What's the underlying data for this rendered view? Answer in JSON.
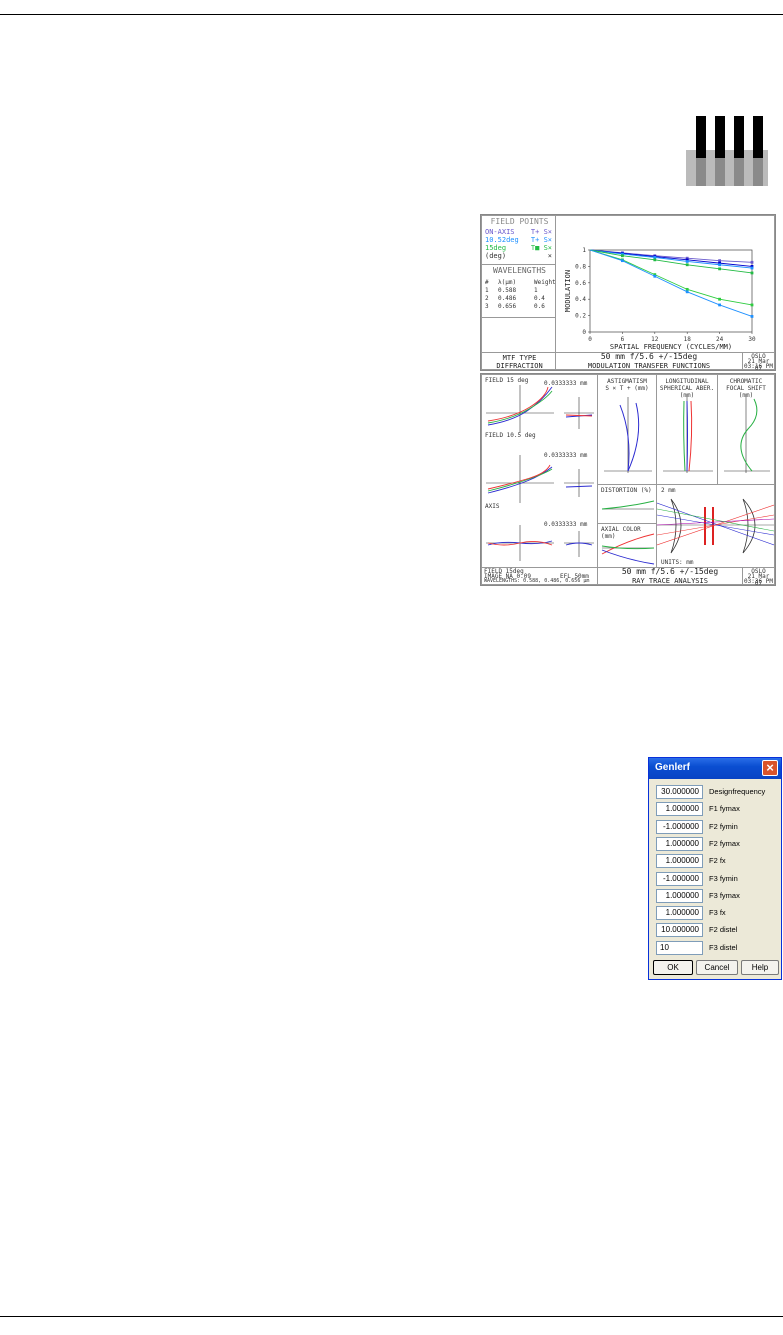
{
  "mtf_panel": {
    "field_points": {
      "title": "FIELD POINTS",
      "rows": [
        {
          "label": "ON-AXIS",
          "ts": "T+ S×",
          "color": "#6a5acd"
        },
        {
          "label": "10.52deg",
          "ts": "T+ S×",
          "color": "#1e90ff"
        },
        {
          "label": "15deg",
          "ts": "T■ S×",
          "color": "#22bb44"
        },
        {
          "label": "(deg)",
          "ts": "×",
          "color": "#333333"
        }
      ]
    },
    "wavelengths": {
      "title": "WAVELENGTHS",
      "header": [
        "#",
        "λ(µm)",
        "Weight"
      ],
      "rows": [
        [
          "1",
          "0.588",
          "1"
        ],
        [
          "2",
          "0.486",
          "0.4"
        ],
        [
          "3",
          "0.656",
          "0.6"
        ]
      ]
    },
    "mtf_type": {
      "line1": "MTF TYPE",
      "line2": "DIFFRACTION"
    },
    "caption": {
      "line1": "50 mm f/5.6 +/-15deg",
      "line2": "MODULATION TRANSFER FUNCTIONS"
    },
    "stamp": {
      "line1": "OSLO",
      "line2": "21 Mar 07",
      "line3": "03:16 PM"
    }
  },
  "chart_data": {
    "type": "line",
    "title": "",
    "xlabel": "SPATIAL FREQUENCY (CYCLES/MM)",
    "ylabel": "MODULATION",
    "xlim": [
      0,
      30
    ],
    "ylim": [
      0,
      1
    ],
    "x_ticks": [
      "0",
      "6",
      "12",
      "18",
      "24",
      "30"
    ],
    "y_ticks": [
      "0",
      "0.2",
      "0.4",
      "0.6",
      "0.8",
      "1"
    ],
    "x": [
      0,
      6,
      12,
      18,
      24,
      30
    ],
    "series": [
      {
        "color": "#6a5acd",
        "values": [
          1.0,
          0.965,
          0.93,
          0.9,
          0.87,
          0.85
        ]
      },
      {
        "color": "#0000cd",
        "values": [
          1.0,
          0.96,
          0.92,
          0.88,
          0.84,
          0.8
        ]
      },
      {
        "color": "#1e90ff",
        "values": [
          1.0,
          0.95,
          0.91,
          0.86,
          0.82,
          0.78
        ]
      },
      {
        "color": "#22bb44",
        "values": [
          1.0,
          0.93,
          0.88,
          0.82,
          0.77,
          0.72
        ]
      },
      {
        "color": "#2ecc40",
        "values": [
          1.0,
          0.88,
          0.7,
          0.52,
          0.4,
          0.33
        ]
      },
      {
        "color": "#1e90ff",
        "values": [
          1.0,
          0.87,
          0.68,
          0.49,
          0.33,
          0.19
        ]
      }
    ]
  },
  "ray_panel": {
    "fan_labels": [
      "FIELD 15 deg",
      "FIELD 10.5 deg",
      "AXIS"
    ],
    "fan_scale": "0.0333333 mm",
    "astig": {
      "line1": "ASTIGMATISM",
      "line2": "S ×  T +  (mm)"
    },
    "longsph": {
      "line1": "LONGITUDINAL",
      "line2": "SPHERICAL ABER. (mm)"
    },
    "chrom": {
      "line1": "CHROMATIC",
      "line2": "FOCAL SHIFT (mm)"
    },
    "distortion": "DISTORTION (%)",
    "axial_color": "AXIAL COLOR (mm)",
    "units": "UNITS: mm",
    "scale_label": "2 mm",
    "footer_left": {
      "line1": "FIELD  15deg",
      "line2": "IMAGE NA  0.09",
      "line3": "EFL  50mm",
      "line4": "WAVELENGTHS: 0.588, 0.486, 0.656 µm"
    },
    "caption": {
      "line1": "50 mm f/5.6 +/-15deg",
      "line2": "RAY TRACE ANALYSIS"
    },
    "stamp": {
      "line1": "OSLO",
      "line2": "21 Mar 07",
      "line3": "03:36 PM"
    }
  },
  "dialog": {
    "title": "Genlerf",
    "fields": [
      {
        "value": "30.000000",
        "label": "Designfrequency"
      },
      {
        "value": "1.000000",
        "label": "F1 fymax"
      },
      {
        "value": "-1.000000",
        "label": "F2 fymin"
      },
      {
        "value": "1.000000",
        "label": "F2 fymax"
      },
      {
        "value": "1.000000",
        "label": "F2 fx"
      },
      {
        "value": "-1.000000",
        "label": "F3 fymin"
      },
      {
        "value": "1.000000",
        "label": "F3 fymax"
      },
      {
        "value": "1.000000",
        "label": "F3 fx"
      },
      {
        "value": "10.000000",
        "label": "F2 distel"
      },
      {
        "value": "10",
        "label": "F3 distel"
      }
    ],
    "buttons": {
      "ok": "OK",
      "cancel": "Cancel",
      "help": "Help"
    }
  }
}
